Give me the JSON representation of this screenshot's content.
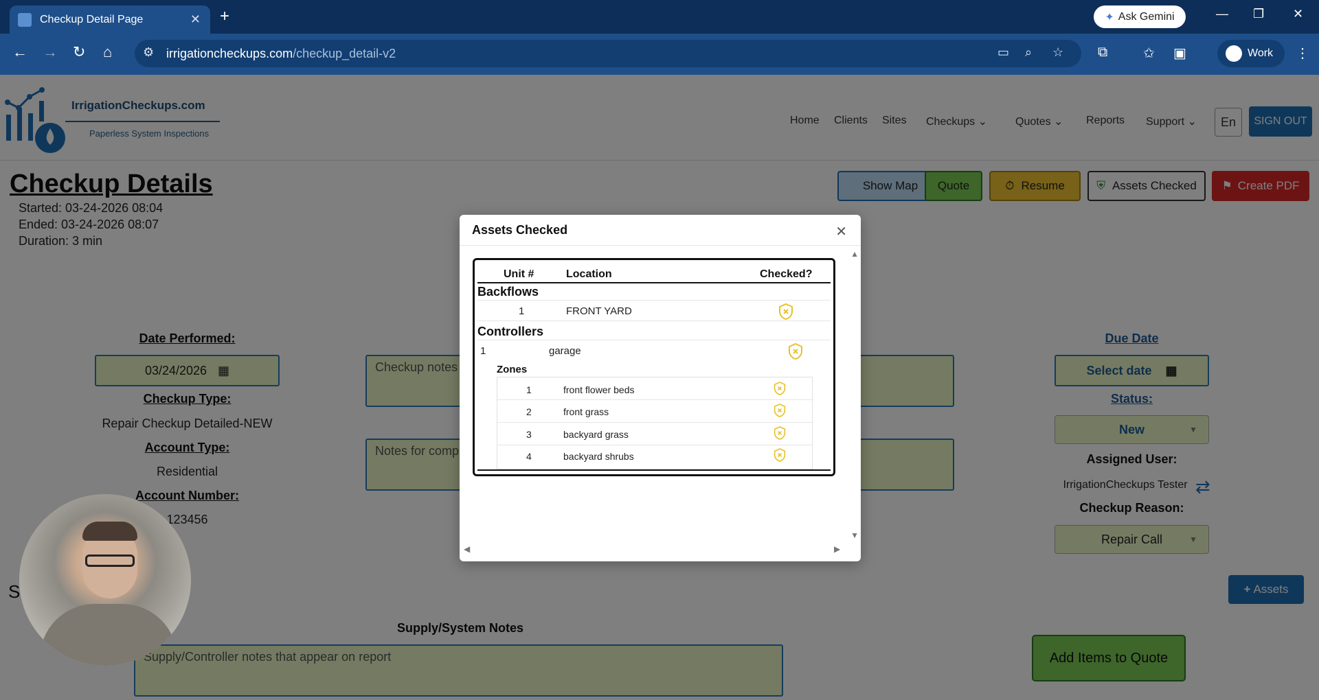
{
  "browser": {
    "tab_title": "Checkup Detail Page",
    "ask_gemini": "Ask Gemini",
    "url_domain": "irrigationcheckups.com",
    "url_path": "/checkup_detail-v2",
    "profile": "Work"
  },
  "header": {
    "logo_title": "IrrigationCheckups.com",
    "logo_tagline": "Paperless System Inspections",
    "nav": [
      "Home",
      "Clients",
      "Sites",
      "Checkups",
      "Quotes",
      "Reports",
      "Support"
    ],
    "lang": "En",
    "sign_out": "SIGN OUT"
  },
  "checkup": {
    "title": "Checkup Details",
    "started": "Started: 03-24-2026 08:04",
    "ended": "Ended: 03-24-2026 08:07",
    "duration": "Duration: 3 min",
    "actions": {
      "show_map": "Show Map",
      "quote": "Quote",
      "resume": "Resume",
      "assets_checked": "Assets Checked",
      "create_pdf": "Create PDF"
    },
    "date_performed_label": "Date Performed:",
    "date_performed": "03/24/2026",
    "checkup_type_label": "Checkup Type:",
    "checkup_type": "Repair Checkup Detailed-NEW",
    "account_type_label": "Account Type:",
    "account_type": "Residential",
    "account_number_label": "Account Number:",
    "account_number": "123456",
    "checkup_notes_placeholder": "Checkup notes",
    "notes_comp_placeholder": "Notes for comp",
    "due_date_label": "Due Date",
    "due_date_placeholder": "Select date",
    "status_label": "Status:",
    "status": "New",
    "assigned_user_label": "Assigned User:",
    "assigned_user": "IrrigationCheckups Tester",
    "checkup_reason_label": "Checkup Reason:",
    "checkup_reason": "Repair Call",
    "assets_button": "Assets",
    "supply_section_label": "Supply/System Notes",
    "supply_notes_placeholder": "Supply/Controller notes that appear on report",
    "add_items_button": "Add Items to Quote",
    "section_initial": "S"
  },
  "modal": {
    "title": "Assets Checked",
    "columns": [
      "Unit #",
      "Location",
      "Checked?"
    ],
    "backflows_label": "Backflows",
    "backflows": [
      {
        "unit": "1",
        "location": "FRONT YARD"
      }
    ],
    "controllers_label": "Controllers",
    "controller": {
      "unit": "1",
      "location": "garage"
    },
    "zones_label": "Zones",
    "zones": [
      {
        "unit": "1",
        "location": "front flower beds"
      },
      {
        "unit": "2",
        "location": "front grass"
      },
      {
        "unit": "3",
        "location": "backyard grass"
      },
      {
        "unit": "4",
        "location": "backyard shrubs"
      }
    ]
  },
  "colors": {
    "field_bg": "#eaf7c5",
    "brand_blue": "#1f6fb5",
    "shield_yellow": "#e8c12a",
    "pdf_red": "#d92828"
  }
}
